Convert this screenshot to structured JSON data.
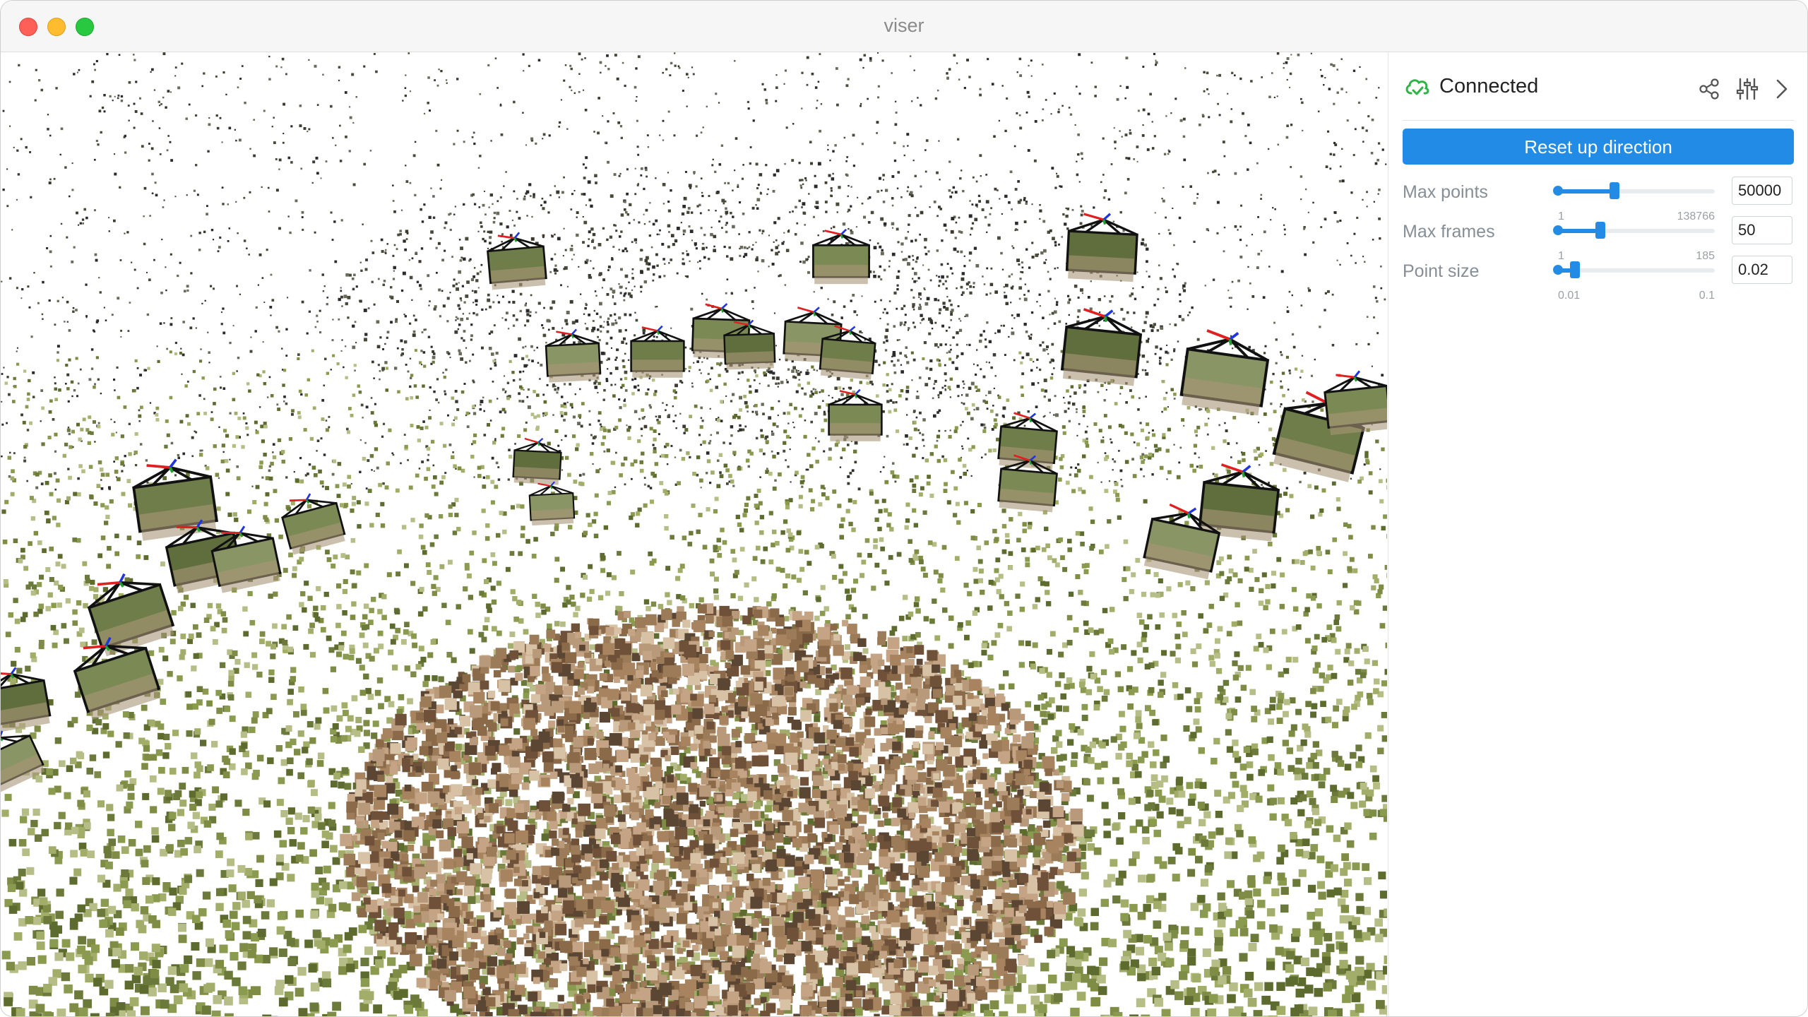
{
  "window": {
    "title": "viser"
  },
  "panel": {
    "status": "Connected",
    "icons": [
      "cloud-check-icon",
      "share-icon",
      "sliders-icon",
      "chevron-right-icon"
    ],
    "reset_button": "Reset up direction",
    "controls": [
      {
        "label": "Max points",
        "value": "50000",
        "min": "1",
        "max": "138766",
        "fraction": 0.36
      },
      {
        "label": "Max frames",
        "value": "50",
        "min": "1",
        "max": "185",
        "fraction": 0.27
      },
      {
        "label": "Point size",
        "value": "0.02",
        "min": "0.01",
        "max": "0.1",
        "fraction": 0.11
      }
    ]
  },
  "colors": {
    "accent": "#228be6",
    "status_green": "#2fb344",
    "close": "#fe5f57",
    "minimize": "#febc2e",
    "maximize": "#28c840"
  }
}
